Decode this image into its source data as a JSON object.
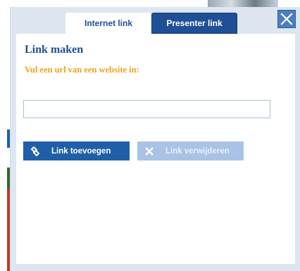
{
  "tabs": {
    "internet_label": "Internet link",
    "presenter_label": "Presenter link"
  },
  "panel": {
    "title": "Link maken",
    "instruction": "Vul een url van een website in:"
  },
  "url_input": {
    "value": "",
    "placeholder": ""
  },
  "buttons": {
    "add_label": "Link toevoegen",
    "remove_label": "Link verwijderen"
  },
  "icons": {
    "close": "close-icon",
    "add": "link-icon",
    "remove": "x-icon"
  },
  "colors": {
    "accent_blue": "#1f4f96",
    "button_blue": "#1f5fa8",
    "button_disabled": "#a8c3e6",
    "instruction_orange": "#f0a31b",
    "dialog_bg": "#dde6f1"
  }
}
